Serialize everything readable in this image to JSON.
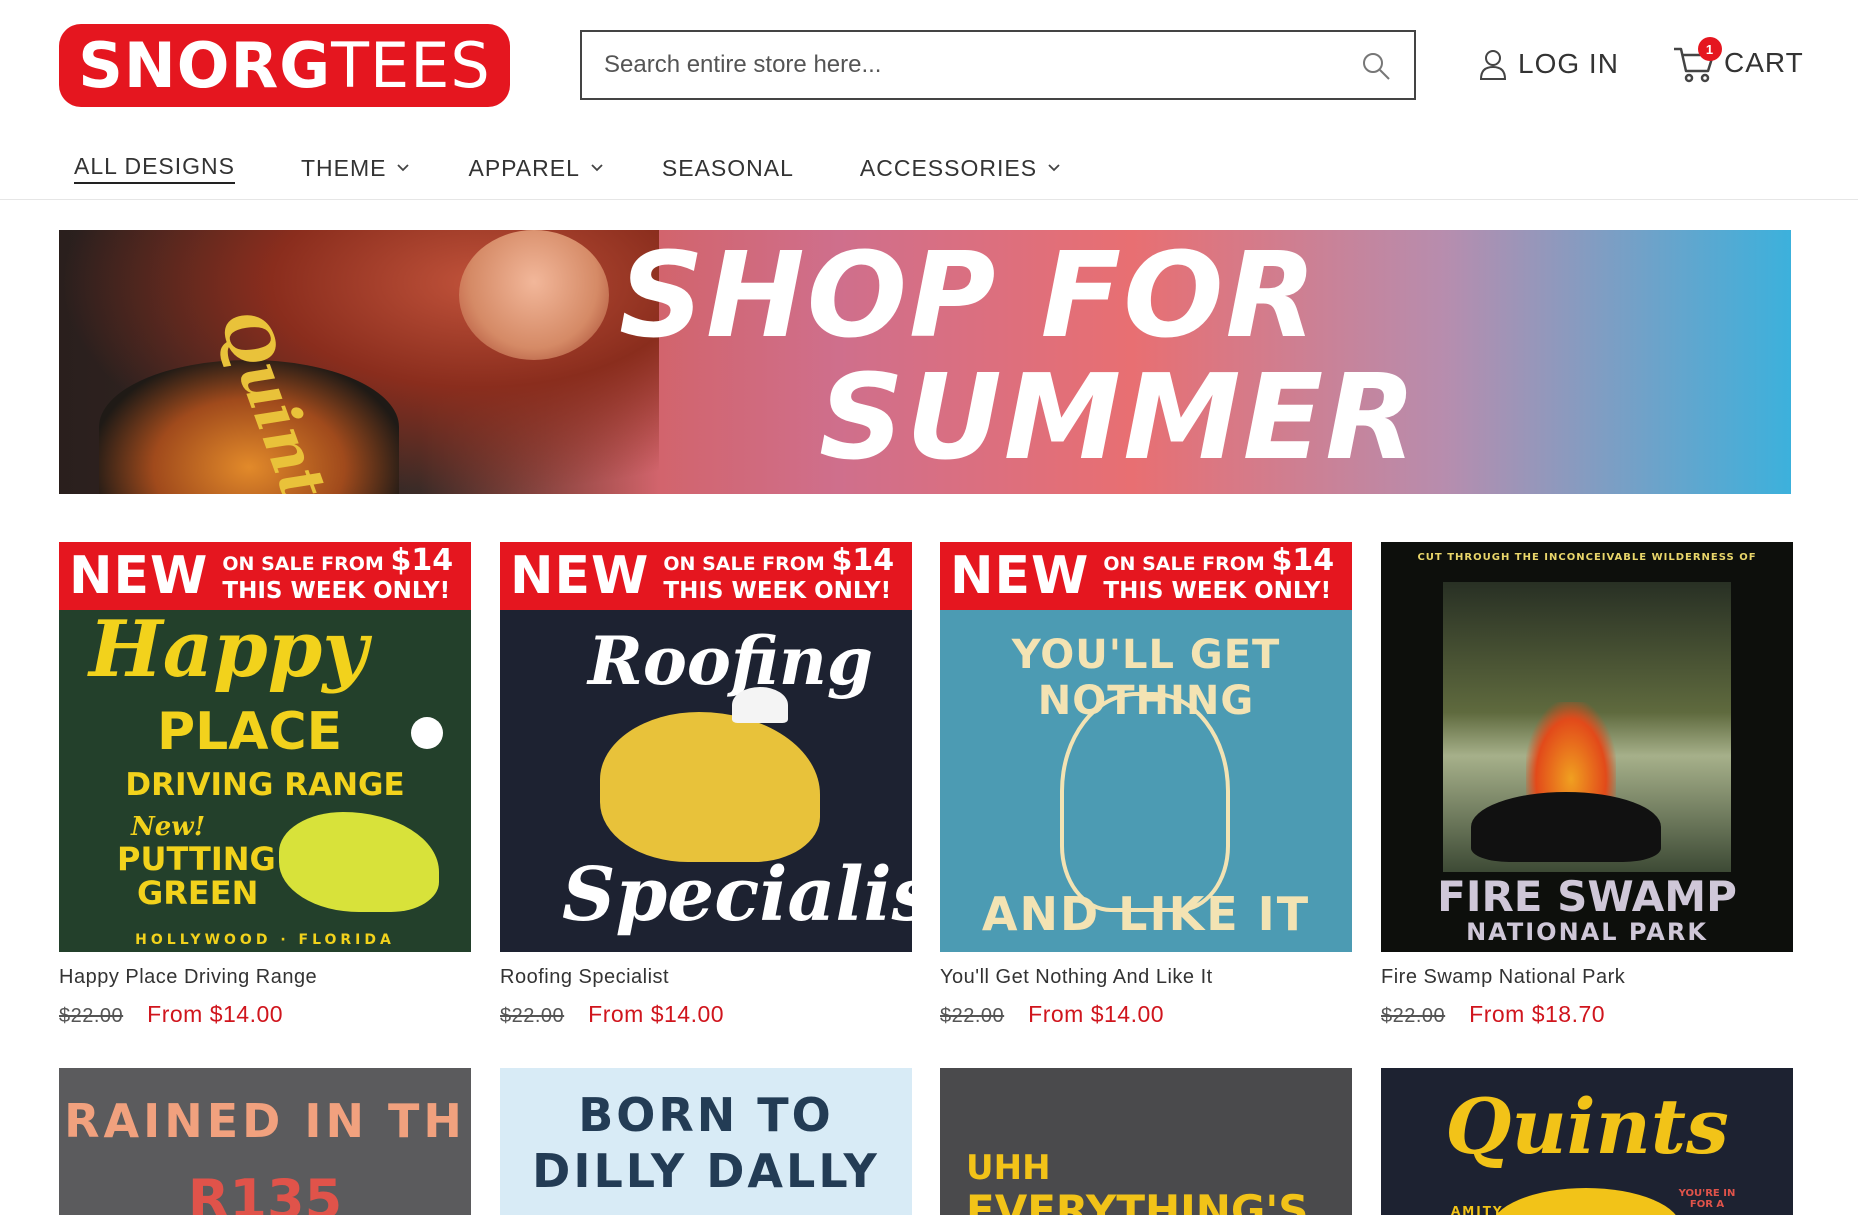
{
  "brand": {
    "name_bold": "SNORG",
    "name_light": "TEES",
    "color": "#e5161f"
  },
  "search": {
    "placeholder": "Search entire store here..."
  },
  "account": {
    "login_label": "LOG IN"
  },
  "cart": {
    "label": "CART",
    "count": "1"
  },
  "nav": {
    "items": [
      {
        "label": "ALL DESIGNS",
        "has_dropdown": false,
        "active": true
      },
      {
        "label": "THEME",
        "has_dropdown": true
      },
      {
        "label": "APPAREL",
        "has_dropdown": true
      },
      {
        "label": "SEASONAL",
        "has_dropdown": false
      },
      {
        "label": "ACCESSORIES",
        "has_dropdown": true
      }
    ]
  },
  "banner": {
    "line1": "SHOP FOR",
    "line2": "SUMMER",
    "shirt_text": "Quints"
  },
  "sale_badge": {
    "new": "NEW",
    "line1_prefix": "ON SALE FROM ",
    "line1_amount": "$14",
    "line2": "THIS WEEK ONLY!"
  },
  "products": [
    {
      "name": "Happy Place Driving Range",
      "old_price": "$22.00",
      "price": "From $14.00",
      "badge": true,
      "art": {
        "bg": "#23402b",
        "lines": [
          "Happy",
          "PLACE",
          "DRIVING RANGE",
          "New!",
          "PUTTING",
          "GREEN",
          "HOLLYWOOD · FLORIDA"
        ]
      }
    },
    {
      "name": "Roofing Specialist",
      "old_price": "$22.00",
      "price": "From $14.00",
      "badge": true,
      "art": {
        "bg": "#1d2231",
        "lines": [
          "Roofing",
          "Specialist"
        ]
      }
    },
    {
      "name": "You'll Get Nothing And Like It",
      "old_price": "$22.00",
      "price": "From $14.00",
      "badge": true,
      "art": {
        "bg": "#4c9bb3",
        "lines": [
          "YOU'LL GET NOTHING",
          "AND LIKE IT"
        ]
      }
    },
    {
      "name": "Fire Swamp National Park",
      "old_price": "$22.00",
      "price": "From $18.70",
      "badge": false,
      "art": {
        "bg": "#0d0f0c",
        "lines": [
          "CUT THROUGH THE INCONCEIVABLE WILDERNESS OF",
          "FIRE SWAMP",
          "NATIONAL PARK"
        ]
      }
    },
    {
      "name": "",
      "art": {
        "bg": "#5b5b5d",
        "lines": [
          "RAINED IN TH",
          "R135"
        ]
      }
    },
    {
      "name": "",
      "art": {
        "bg": "#d8ebf6",
        "lines": [
          "BORN TO",
          "DILLY DALLY"
        ]
      }
    },
    {
      "name": "",
      "art": {
        "bg": "#4a4a4c",
        "lines": [
          "UHH",
          "EVERYTHING'S"
        ]
      }
    },
    {
      "name": "",
      "art": {
        "bg": "#1d2231",
        "lines": [
          "Quints",
          "AMITY",
          "YOU'RE IN FOR A"
        ]
      }
    }
  ]
}
